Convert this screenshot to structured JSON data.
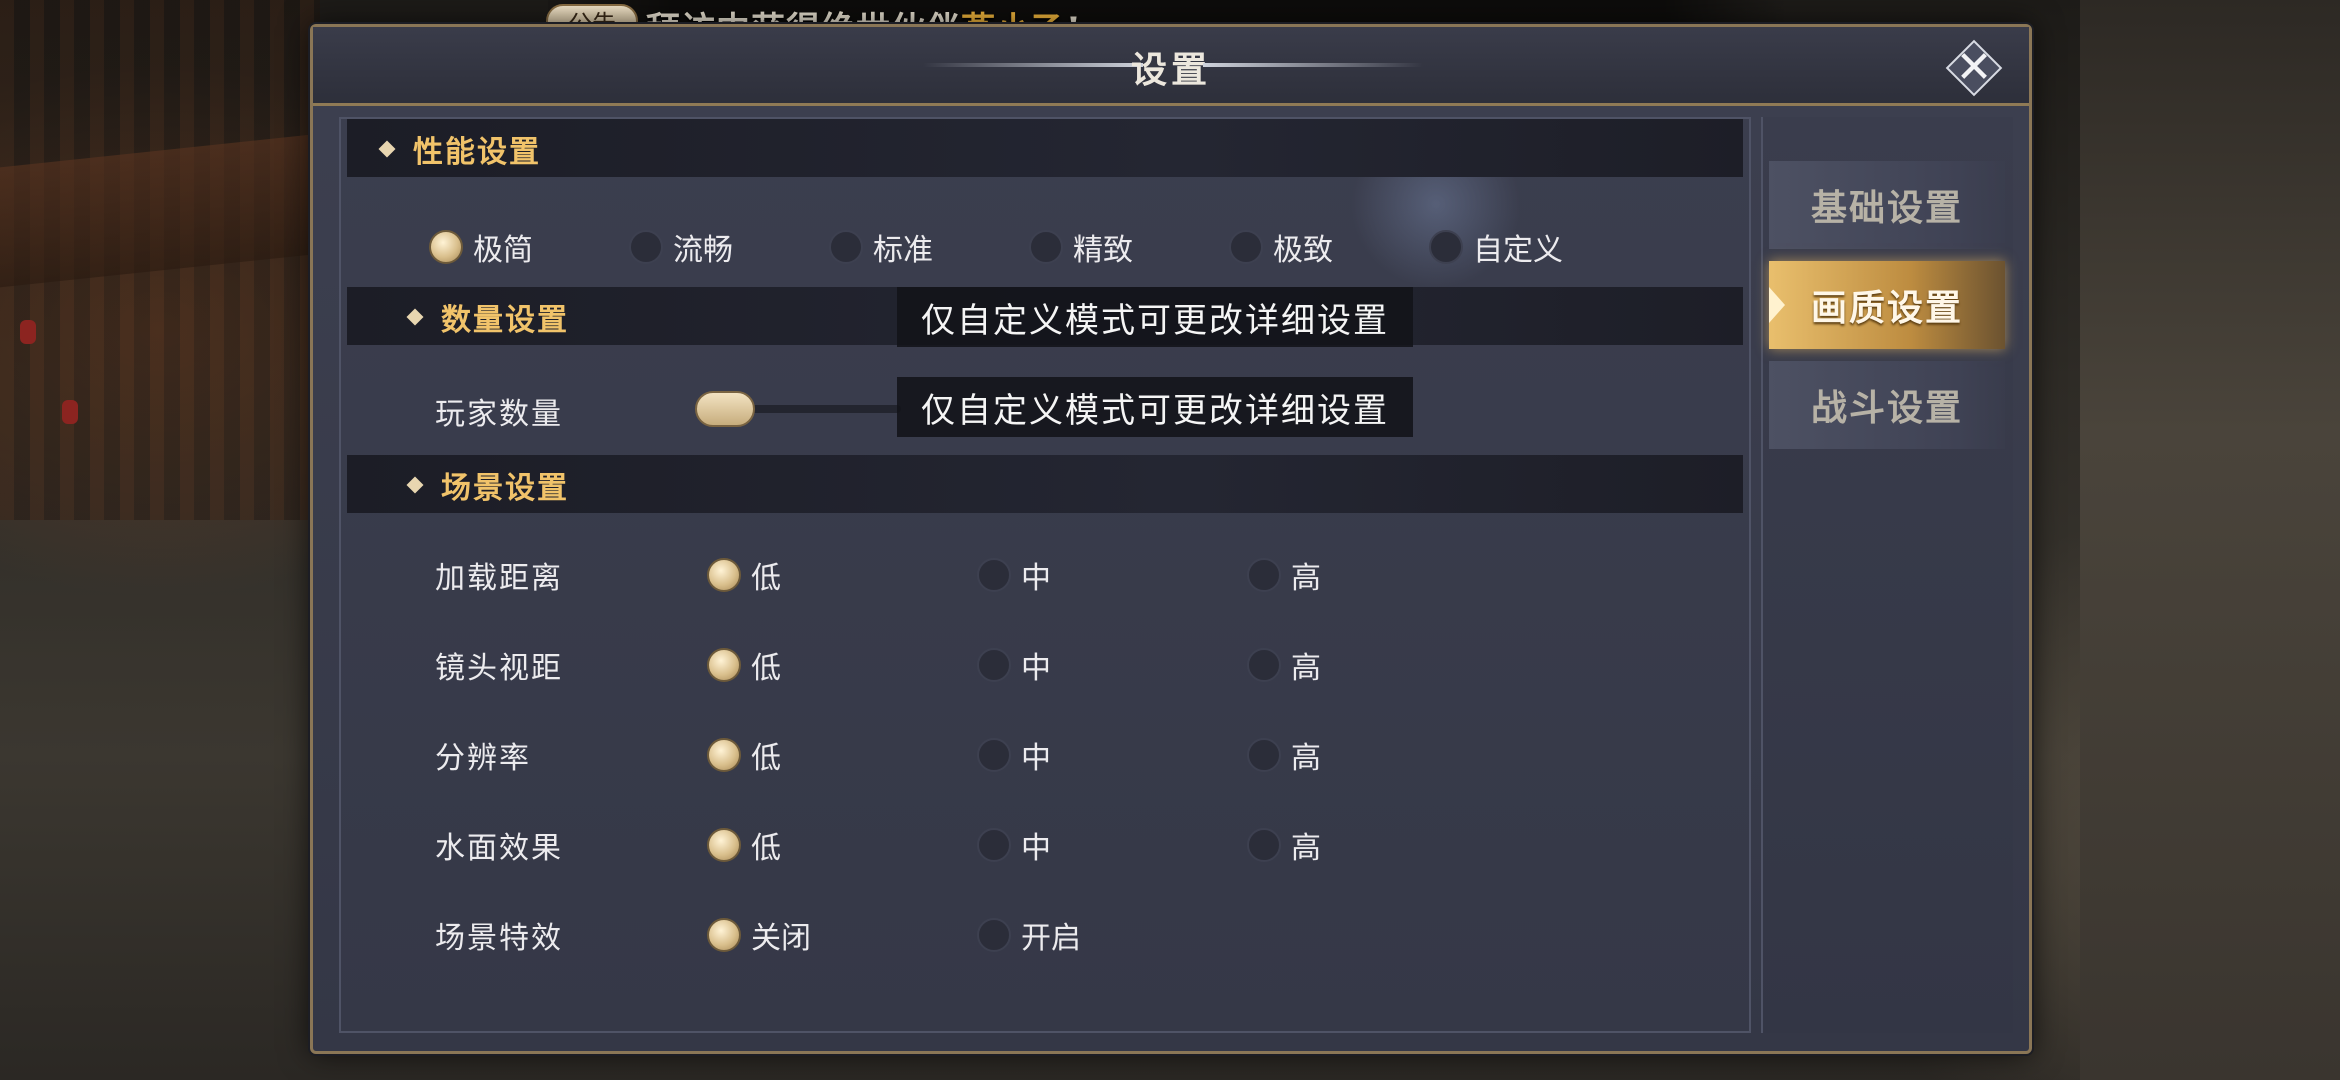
{
  "announcement": {
    "badge": "公告",
    "text_prefix": "拜访中获得绝世伙伴",
    "highlight": "燕小乙",
    "text_suffix": "!"
  },
  "dialog": {
    "title": "设置",
    "close_icon": "close-x-icon"
  },
  "tabs": [
    {
      "label": "基础设置",
      "active": false
    },
    {
      "label": "画质设置",
      "active": true
    },
    {
      "label": "战斗设置",
      "active": false
    }
  ],
  "performance": {
    "title": "性能设置",
    "options": [
      {
        "label": "极简",
        "selected": true
      },
      {
        "label": "流畅",
        "selected": false
      },
      {
        "label": "标准",
        "selected": false
      },
      {
        "label": "精致",
        "selected": false
      },
      {
        "label": "极致",
        "selected": false
      },
      {
        "label": "自定义",
        "selected": false
      }
    ]
  },
  "quantity": {
    "title": "数量设置",
    "player_count_label": "玩家数量",
    "player_count_level": 0,
    "tip": "仅自定义模式可更改详细设置"
  },
  "scene": {
    "title": "场景设置",
    "rows": [
      {
        "label": "加载距离",
        "options": [
          "低",
          "中",
          "高"
        ],
        "selected": 0
      },
      {
        "label": "镜头视距",
        "options": [
          "低",
          "中",
          "高"
        ],
        "selected": 0
      },
      {
        "label": "分辨率",
        "options": [
          "低",
          "中",
          "高"
        ],
        "selected": 0
      },
      {
        "label": "水面效果",
        "options": [
          "低",
          "中",
          "高"
        ],
        "selected": 0
      },
      {
        "label": "场景特效",
        "options": [
          "关闭",
          "开启"
        ],
        "selected": 0
      }
    ]
  },
  "colors": {
    "accent_gold": "#f1c36a",
    "active_tab": "#e9bf6d",
    "panel": "#3b3e4e"
  }
}
